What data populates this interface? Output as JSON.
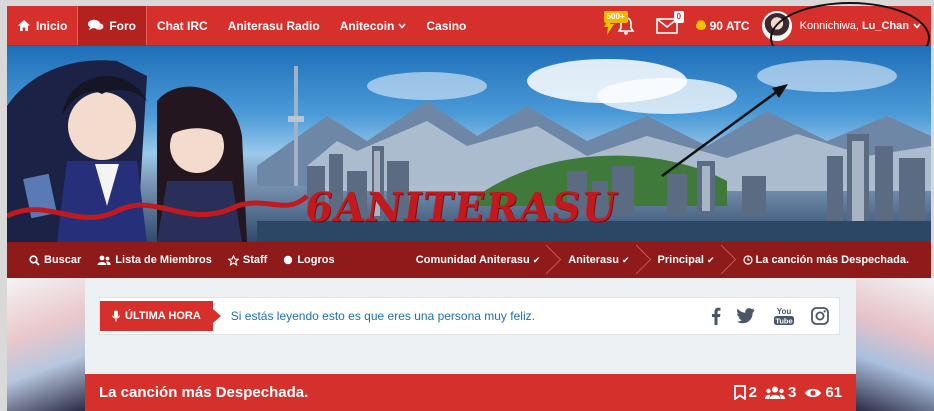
{
  "topnav": {
    "items": [
      {
        "label": "Inicio",
        "icon": "home-icon"
      },
      {
        "label": "Foro",
        "icon": "comments-icon"
      },
      {
        "label": "Chat IRC"
      },
      {
        "label": "Aniterasu Radio"
      },
      {
        "label": "Anitecoin"
      },
      {
        "label": "Casino"
      }
    ],
    "notifications": {
      "badge": "500+",
      "icon": "bell-icon"
    },
    "messages": {
      "badge": "0",
      "icon": "envelope-icon"
    },
    "currency": {
      "value": "90 ATC",
      "icon": "coins-icon"
    },
    "user": {
      "greeting": "Konnichiwa,",
      "name": "Lu_Chan"
    }
  },
  "banner": {
    "logo_text": "ANITERASU",
    "logo_numeral": "6"
  },
  "subnav": {
    "items": [
      {
        "label": "Buscar",
        "icon": "search-icon"
      },
      {
        "label": "Lista de Miembros",
        "icon": "users-icon"
      },
      {
        "label": "Staff",
        "icon": "star-icon"
      },
      {
        "label": "Logros",
        "icon": "circle-icon"
      }
    ],
    "breadcrumbs": [
      {
        "label": "Comunidad Aniterasu"
      },
      {
        "label": "Aniterasu"
      },
      {
        "label": "Principal"
      },
      {
        "label": "La canción más Despechada."
      }
    ]
  },
  "ticker": {
    "label": "ÚLTIMA HORA",
    "text": "Si estás leyendo esto es que eres una persona muy feliz."
  },
  "social": [
    "facebook-icon",
    "twitter-icon",
    "youtube-icon",
    "instagram-icon"
  ],
  "thread": {
    "title": "La canción más Despechada.",
    "stats": {
      "bookmarks": "2",
      "participants": "3",
      "views": "61"
    }
  },
  "colors": {
    "primary": "#d6302c",
    "secondary_nav": "#8e1a1a",
    "link": "#1f6fb0"
  }
}
